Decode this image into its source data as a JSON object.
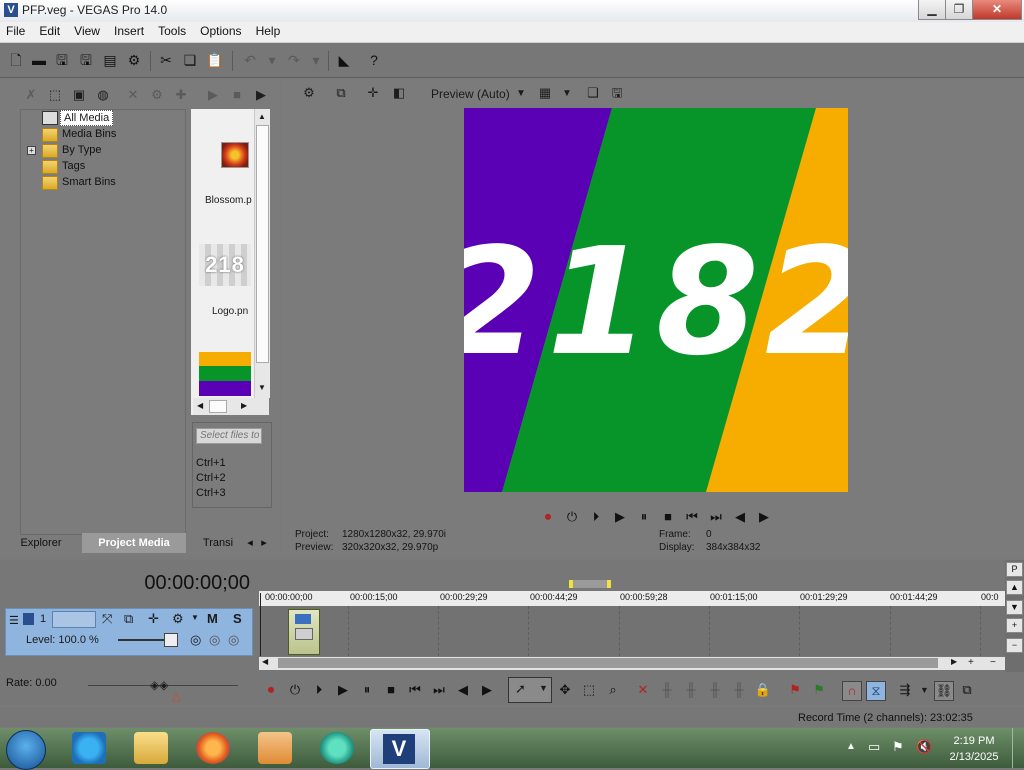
{
  "window": {
    "title": "PFP.veg - VEGAS Pro 14.0",
    "logo_letter": "V",
    "min_label": "▁",
    "max_label": "❐",
    "close_label": "✕"
  },
  "menu": [
    "File",
    "Edit",
    "View",
    "Insert",
    "Tools",
    "Options",
    "Help"
  ],
  "explorer": {
    "tree": [
      {
        "label": "All Media",
        "selected": true
      },
      {
        "label": "Media Bins"
      },
      {
        "label": "By Type",
        "expandable": true
      },
      {
        "label": "Tags"
      },
      {
        "label": "Smart Bins"
      }
    ],
    "expand_glyph": "+",
    "media": [
      {
        "label": "Blossom.p"
      },
      {
        "label": "Logo.pn",
        "thumb_text": "218"
      }
    ],
    "search_placeholder": "Select files to",
    "shortcuts": [
      "Ctrl+1",
      "Ctrl+2",
      "Ctrl+3"
    ],
    "tabs": [
      {
        "label": "Explorer"
      },
      {
        "label": "Project Media",
        "active": true
      },
      {
        "label": "Transi"
      }
    ],
    "tab_arrows": [
      "◂",
      "▸"
    ]
  },
  "preview": {
    "mode_label": "Preview (Auto)",
    "image_text": "2182",
    "stripe_colors": [
      "#5a00b5",
      "#07952a",
      "#f7ad00"
    ],
    "project_label": "Project:",
    "project_value": "1280x1280x32, 29.970i",
    "preview_label": "Preview:",
    "preview_value": "320x320x32, 29.970p",
    "frame_label": "Frame:",
    "frame_value": "0",
    "display_label": "Display:",
    "display_value": "384x384x32"
  },
  "timeline": {
    "timecode": "00:00:00;00",
    "track_number": "1",
    "level_label": "Level: 100.0 %",
    "mute_label": "M",
    "solo_label": "S",
    "ruler_ticks": [
      "00:00:00;00",
      "00:00:15;00",
      "00:00:29;29",
      "00:00:44;29",
      "00:00:59;28",
      "00:01:15;00",
      "00:01:29;29",
      "00:01:44;29",
      "00:0"
    ],
    "rate_label": "Rate: 0.00",
    "record_time": "Record Time (2 channels): 23:02:35"
  },
  "right_controls": [
    "P",
    "▲",
    "▼",
    "+",
    "−"
  ],
  "taskbar": {
    "time": "2:19 PM",
    "date": "2/13/2025"
  }
}
